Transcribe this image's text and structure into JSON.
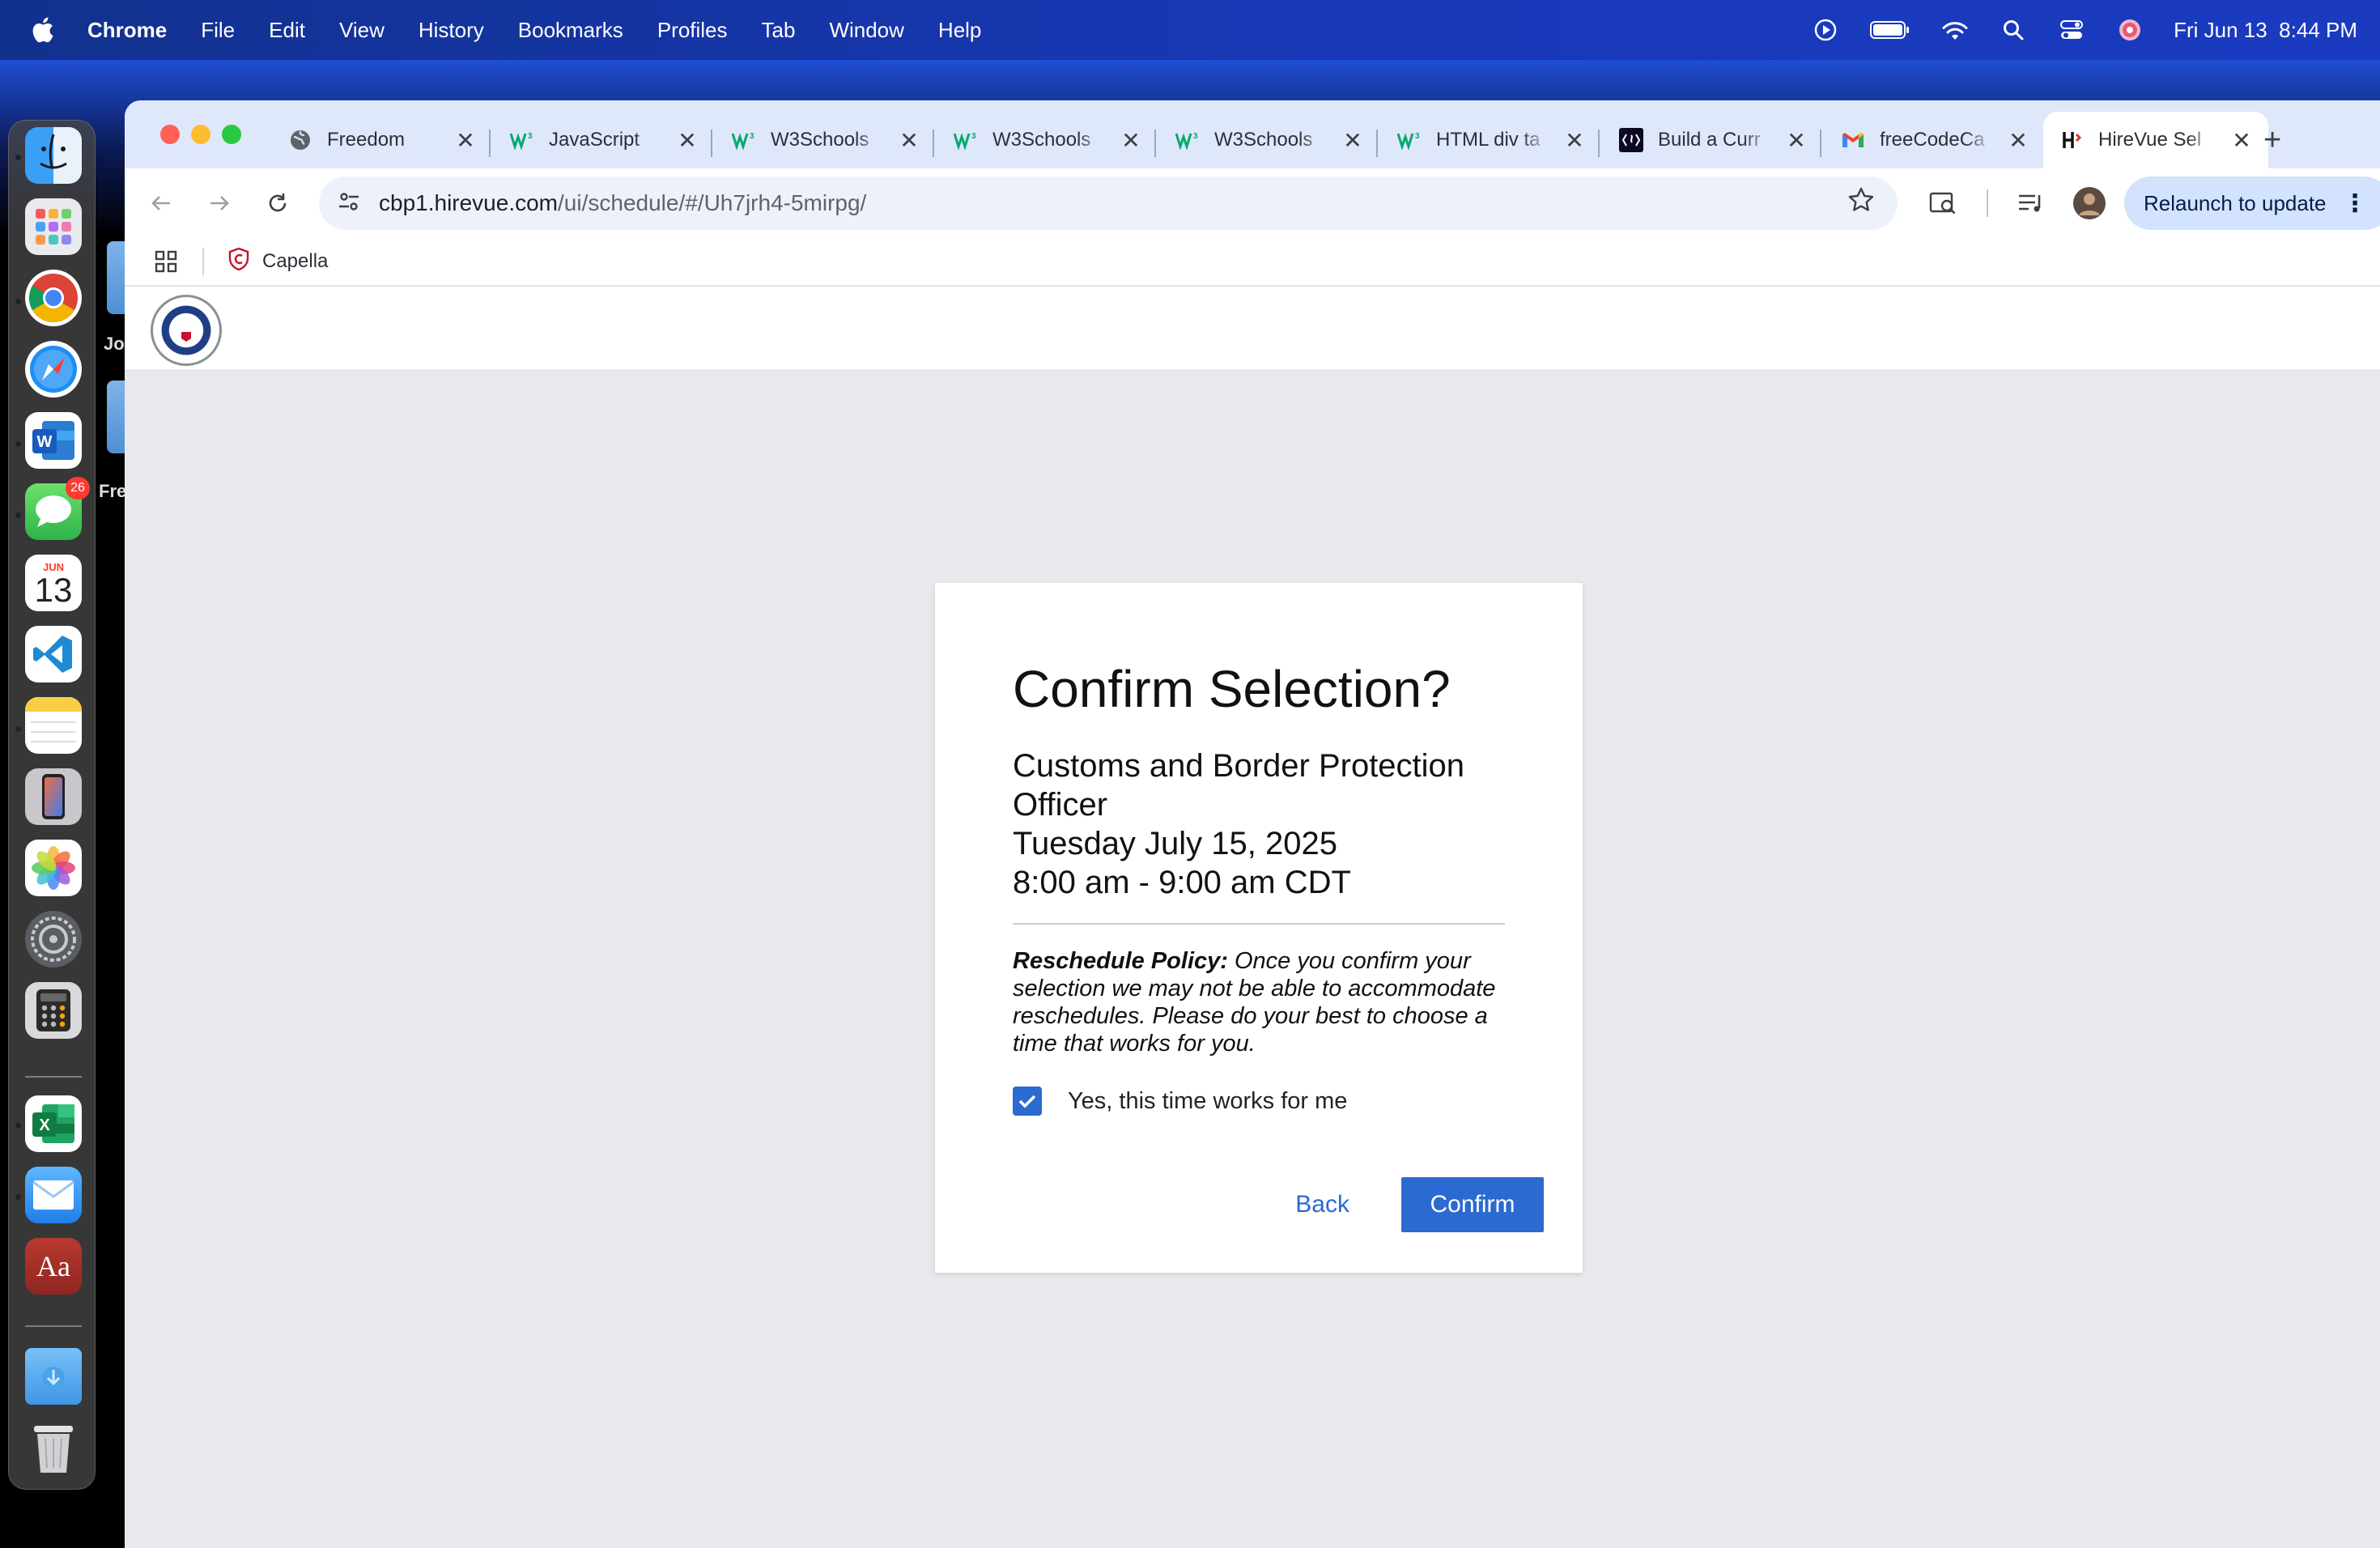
{
  "menubar": {
    "app_name": "Chrome",
    "items": [
      "File",
      "Edit",
      "View",
      "History",
      "Bookmarks",
      "Profiles",
      "Tab",
      "Window",
      "Help"
    ],
    "date": "Fri Jun 13",
    "time": "8:44 PM"
  },
  "desktop": {
    "labels": [
      "Jo",
      "Fre"
    ]
  },
  "dock": {
    "messages_badge": "26",
    "calendar_month": "JUN",
    "calendar_day": "13",
    "dictionary_label": "Aa"
  },
  "tabs": [
    {
      "title": "Freedom",
      "icon": "globe-icon"
    },
    {
      "title": "JavaScript",
      "icon": "w3schools-icon"
    },
    {
      "title": "W3Schools",
      "icon": "w3schools-icon"
    },
    {
      "title": "W3Schools",
      "icon": "w3schools-icon"
    },
    {
      "title": "W3Schools",
      "icon": "w3schools-icon"
    },
    {
      "title": "HTML div ta",
      "icon": "w3schools-icon"
    },
    {
      "title": "Build a Curr",
      "icon": "freecodecamp-icon"
    },
    {
      "title": "freeCodeCa",
      "icon": "gmail-icon"
    },
    {
      "title": "HireVue Sel",
      "icon": "hirevue-icon",
      "active": true
    }
  ],
  "toolbar": {
    "url_host": "cbp1.hirevue.com",
    "url_path": "/ui/schedule/#/Uh7jrh4-5mirpg/",
    "relaunch_label": "Relaunch to update"
  },
  "bookmarks": {
    "items": [
      "Capella"
    ]
  },
  "dialog": {
    "title": "Confirm Selection?",
    "position": "Customs and Border Protection Officer",
    "date": "Tuesday July 15, 2025",
    "time": "8:00 am - 9:00 am CDT",
    "policy_label": "Reschedule Policy:",
    "policy_text": " Once you confirm your selection we may not be able to accommodate reschedules. Please do your best to choose a time that works for you.",
    "checkbox_label": "Yes, this time works for me",
    "checkbox_checked": true,
    "back_label": "Back",
    "confirm_label": "Confirm"
  },
  "colors": {
    "accent": "#2b6ad1",
    "page_background": "#e8e9ec",
    "tabstrip": "#dfe7fb"
  }
}
